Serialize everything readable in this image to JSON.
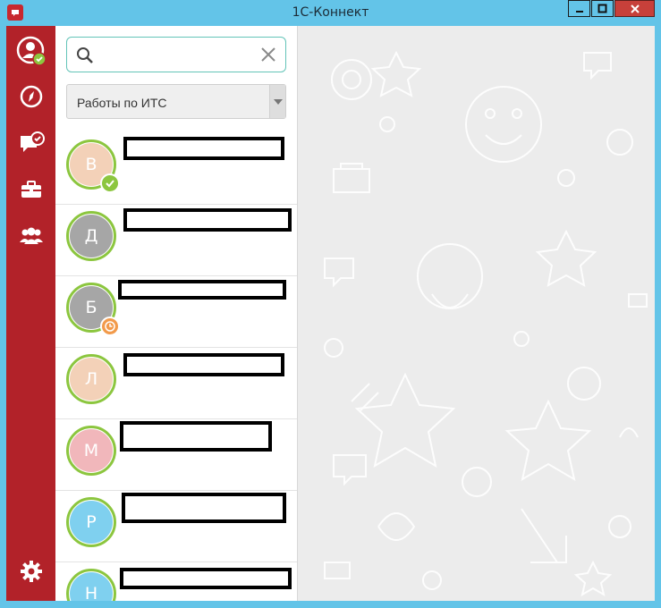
{
  "window": {
    "title": "1С-Коннект"
  },
  "colors": {
    "nav_bg": "#b22229",
    "titlebar": "#63c4e8",
    "online": "#8cc63f",
    "away": "#f29a4a",
    "wallpaper": "#ececec"
  },
  "nav": {
    "items": [
      {
        "icon": "user-profile-icon"
      },
      {
        "icon": "compass-icon"
      },
      {
        "icon": "chat-check-icon"
      },
      {
        "icon": "briefcase-icon"
      },
      {
        "icon": "people-group-icon"
      },
      {
        "icon": "gear-icon"
      }
    ]
  },
  "search": {
    "value": "",
    "placeholder": ""
  },
  "filter": {
    "selected": "Работы по ИТС"
  },
  "contacts": [
    {
      "initial": "В",
      "color": "#f3d1b8",
      "status": "online"
    },
    {
      "initial": "Д",
      "color": "#a6a6a6",
      "status": ""
    },
    {
      "initial": "Б",
      "color": "#a6a6a6",
      "status": "away"
    },
    {
      "initial": "Л",
      "color": "#f3d1b8",
      "status": ""
    },
    {
      "initial": "М",
      "color": "#f1b7bb",
      "status": ""
    },
    {
      "initial": "Р",
      "color": "#7fd0ef",
      "status": ""
    },
    {
      "initial": "Н",
      "color": "#7fd0ef",
      "status": ""
    }
  ]
}
